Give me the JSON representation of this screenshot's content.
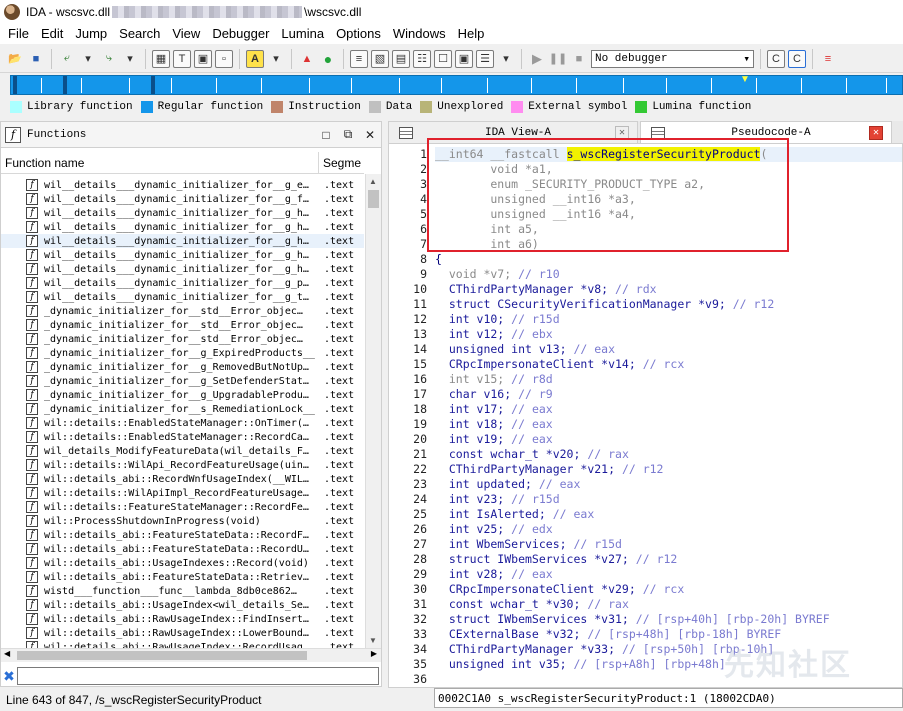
{
  "window": {
    "title_prefix": "IDA - wscsvc.dll",
    "title_suffix": "\\wscsvc.dll"
  },
  "menu": [
    "File",
    "Edit",
    "Jump",
    "Search",
    "View",
    "Debugger",
    "Lumina",
    "Options",
    "Windows",
    "Help"
  ],
  "toolbar": {
    "debugger_value": "No debugger"
  },
  "legend": [
    {
      "label": "Library function",
      "color": "#aaffff"
    },
    {
      "label": "Regular function",
      "color": "#1496ea"
    },
    {
      "label": "Instruction",
      "color": "#c0846a"
    },
    {
      "label": "Data",
      "color": "#c0c0c0"
    },
    {
      "label": "Unexplored",
      "color": "#b8b478"
    },
    {
      "label": "External symbol",
      "color": "#ff8cf0"
    },
    {
      "label": "Lumina function",
      "color": "#34c934"
    }
  ],
  "functions": {
    "title": "Functions",
    "col_name": "Function name",
    "col_segment": "Segme",
    "rows": [
      {
        "name": "wil__details___dynamic_initializer_for__g_e…",
        "seg": ".text"
      },
      {
        "name": "wil__details___dynamic_initializer_for__g_f…",
        "seg": ".text"
      },
      {
        "name": "wil__details___dynamic_initializer_for__g_h…",
        "seg": ".text"
      },
      {
        "name": "wil__details___dynamic_initializer_for__g_h…",
        "seg": ".text"
      },
      {
        "name": "wil__details___dynamic_initializer_for__g_h…",
        "seg": ".text"
      },
      {
        "name": "wil__details___dynamic_initializer_for__g_h…",
        "seg": ".text"
      },
      {
        "name": "wil__details___dynamic_initializer_for__g_h…",
        "seg": ".text"
      },
      {
        "name": "wil__details___dynamic_initializer_for__g_p…",
        "seg": ".text"
      },
      {
        "name": "wil__details___dynamic_initializer_for__g_t…",
        "seg": ".text"
      },
      {
        "name": "_dynamic_initializer_for__std__Error_objec…",
        "seg": ".text"
      },
      {
        "name": "_dynamic_initializer_for__std__Error_objec…",
        "seg": ".text"
      },
      {
        "name": "_dynamic_initializer_for__std__Error_objec…",
        "seg": ".text"
      },
      {
        "name": "_dynamic_initializer_for__g_ExpiredProducts__",
        "seg": ".text"
      },
      {
        "name": "_dynamic_initializer_for__g_RemovedButNotUp…",
        "seg": ".text"
      },
      {
        "name": "_dynamic_initializer_for__g_SetDefenderStat…",
        "seg": ".text"
      },
      {
        "name": "_dynamic_initializer_for__g_UpgradableProdu…",
        "seg": ".text"
      },
      {
        "name": "_dynamic_initializer_for__s_RemediationLock__",
        "seg": ".text"
      },
      {
        "name": "wil::details::EnabledStateManager::OnTimer(…",
        "seg": ".text"
      },
      {
        "name": "wil::details::EnabledStateManager::RecordCa…",
        "seg": ".text"
      },
      {
        "name": "wil_details_ModifyFeatureData(wil_details_F…",
        "seg": ".text"
      },
      {
        "name": "wil::details::WilApi_RecordFeatureUsage(uin…",
        "seg": ".text"
      },
      {
        "name": "wil::details_abi::RecordWnfUsageIndex(__WIL…",
        "seg": ".text"
      },
      {
        "name": "wil::details::WilApiImpl_RecordFeatureUsage…",
        "seg": ".text"
      },
      {
        "name": "wil::details::FeatureStateManager::RecordFe…",
        "seg": ".text"
      },
      {
        "name": "wil::ProcessShutdownInProgress(void)",
        "seg": ".text"
      },
      {
        "name": "wil::details_abi::FeatureStateData::RecordF…",
        "seg": ".text"
      },
      {
        "name": "wil::details_abi::FeatureStateData::RecordU…",
        "seg": ".text"
      },
      {
        "name": "wil::details_abi::UsageIndexes::Record(void)",
        "seg": ".text"
      },
      {
        "name": "wil::details_abi::FeatureStateData::Retriev…",
        "seg": ".text"
      },
      {
        "name": "wistd___function___func__lambda_8db0ce862…",
        "seg": ".text"
      },
      {
        "name": "wil::details_abi::UsageIndex<wil_details_Se…",
        "seg": ".text"
      },
      {
        "name": "wil::details_abi::RawUsageIndex::FindInsert…",
        "seg": ".text"
      },
      {
        "name": "wil::details_abi::RawUsageIndex::LowerBound…",
        "seg": ".text"
      },
      {
        "name": "wil::details_abi::RawUsageIndex::RecordUsag…",
        "seg": ".text"
      }
    ]
  },
  "status": {
    "text": "Line 643 of 847, /s_wscRegisterSecurityProduct"
  },
  "tabs": [
    {
      "label": "IDA View-A"
    },
    {
      "label": "Pseudocode-A"
    }
  ],
  "code": {
    "lines": [
      {
        "n": "1",
        "segs": [
          {
            "t": "__int64 __fastcall ",
            "c": "kw-gray"
          },
          {
            "t": "s_wscRegisterSecurityProduct",
            "c": "hl"
          },
          {
            "t": "(",
            "c": "kw-gray"
          }
        ]
      },
      {
        "n": "2",
        "segs": [
          {
            "t": "        void *a1,",
            "c": "kw-gray"
          }
        ]
      },
      {
        "n": "3",
        "segs": [
          {
            "t": "        enum _SECURITY_PRODUCT_TYPE a2,",
            "c": "kw-gray"
          }
        ]
      },
      {
        "n": "4",
        "segs": [
          {
            "t": "        unsigned __int16 *a3,",
            "c": "kw-gray"
          }
        ]
      },
      {
        "n": "5",
        "segs": [
          {
            "t": "        unsigned __int16 *a4,",
            "c": "kw-gray"
          }
        ]
      },
      {
        "n": "6",
        "segs": [
          {
            "t": "        int a5,",
            "c": "kw-gray"
          }
        ]
      },
      {
        "n": "7",
        "segs": [
          {
            "t": "        int a6)",
            "c": "kw-gray"
          }
        ]
      },
      {
        "n": "8",
        "segs": [
          {
            "t": "{",
            "c": "plain"
          }
        ]
      },
      {
        "n": "9",
        "segs": [
          {
            "t": "  void *v7; ",
            "c": "kw-gray"
          },
          {
            "t": "// r10",
            "c": "cmt"
          }
        ]
      },
      {
        "n": "10",
        "segs": [
          {
            "t": "  CThirdPartyManager *v8; ",
            "c": "kw-blue"
          },
          {
            "t": "// rdx",
            "c": "cmt"
          }
        ]
      },
      {
        "n": "11",
        "segs": [
          {
            "t": "  struct CSecurityVerificationManager *v9; ",
            "c": "kw-blue"
          },
          {
            "t": "// r12",
            "c": "cmt"
          }
        ]
      },
      {
        "n": "12",
        "segs": [
          {
            "t": "  int v10; ",
            "c": "kw-blue"
          },
          {
            "t": "// r15d",
            "c": "cmt"
          }
        ]
      },
      {
        "n": "13",
        "segs": [
          {
            "t": "  int v12; ",
            "c": "kw-blue"
          },
          {
            "t": "// ebx",
            "c": "cmt"
          }
        ]
      },
      {
        "n": "14",
        "segs": [
          {
            "t": "  unsigned int v13; ",
            "c": "kw-blue"
          },
          {
            "t": "// eax",
            "c": "cmt"
          }
        ]
      },
      {
        "n": "15",
        "segs": [
          {
            "t": "  CRpcImpersonateClient *v14; ",
            "c": "kw-blue"
          },
          {
            "t": "// rcx",
            "c": "cmt"
          }
        ]
      },
      {
        "n": "16",
        "segs": [
          {
            "t": "  int v15; ",
            "c": "kw-gray"
          },
          {
            "t": "// r8d",
            "c": "cmt"
          }
        ]
      },
      {
        "n": "17",
        "segs": [
          {
            "t": "  char v16; ",
            "c": "kw-blue"
          },
          {
            "t": "// r9",
            "c": "cmt"
          }
        ]
      },
      {
        "n": "18",
        "segs": [
          {
            "t": "  int v17; ",
            "c": "kw-blue"
          },
          {
            "t": "// eax",
            "c": "cmt"
          }
        ]
      },
      {
        "n": "19",
        "segs": [
          {
            "t": "  int v18; ",
            "c": "kw-blue"
          },
          {
            "t": "// eax",
            "c": "cmt"
          }
        ]
      },
      {
        "n": "20",
        "segs": [
          {
            "t": "  int v19; ",
            "c": "kw-blue"
          },
          {
            "t": "// eax",
            "c": "cmt"
          }
        ]
      },
      {
        "n": "21",
        "segs": [
          {
            "t": "  const wchar_t *v20; ",
            "c": "kw-blue"
          },
          {
            "t": "// rax",
            "c": "cmt"
          }
        ]
      },
      {
        "n": "22",
        "segs": [
          {
            "t": "  CThirdPartyManager *v21; ",
            "c": "kw-blue"
          },
          {
            "t": "// r12",
            "c": "cmt"
          }
        ]
      },
      {
        "n": "23",
        "segs": [
          {
            "t": "  int updated; ",
            "c": "kw-blue"
          },
          {
            "t": "// eax",
            "c": "cmt"
          }
        ]
      },
      {
        "n": "24",
        "segs": [
          {
            "t": "  int v23; ",
            "c": "kw-blue"
          },
          {
            "t": "// r15d",
            "c": "cmt"
          }
        ]
      },
      {
        "n": "25",
        "segs": [
          {
            "t": "  int IsAlerted; ",
            "c": "kw-blue"
          },
          {
            "t": "// eax",
            "c": "cmt"
          }
        ]
      },
      {
        "n": "26",
        "segs": [
          {
            "t": "  int v25; ",
            "c": "kw-blue"
          },
          {
            "t": "// edx",
            "c": "cmt"
          }
        ]
      },
      {
        "n": "27",
        "segs": [
          {
            "t": "  int WbemServices; ",
            "c": "kw-blue"
          },
          {
            "t": "// r15d",
            "c": "cmt"
          }
        ]
      },
      {
        "n": "28",
        "segs": [
          {
            "t": "  struct IWbemServices *v27; ",
            "c": "kw-blue"
          },
          {
            "t": "// r12",
            "c": "cmt"
          }
        ]
      },
      {
        "n": "29",
        "segs": [
          {
            "t": "  int v28; ",
            "c": "kw-blue"
          },
          {
            "t": "// eax",
            "c": "cmt"
          }
        ]
      },
      {
        "n": "30",
        "segs": [
          {
            "t": "  CRpcImpersonateClient *v29; ",
            "c": "kw-blue"
          },
          {
            "t": "// rcx",
            "c": "cmt"
          }
        ]
      },
      {
        "n": "31",
        "segs": [
          {
            "t": "  const wchar_t *v30; ",
            "c": "kw-blue"
          },
          {
            "t": "// rax",
            "c": "cmt"
          }
        ]
      },
      {
        "n": "32",
        "segs": [
          {
            "t": "  struct IWbemServices *v31; ",
            "c": "kw-blue"
          },
          {
            "t": "// [rsp+40h] [rbp-20h] BYREF",
            "c": "cmt"
          }
        ]
      },
      {
        "n": "33",
        "segs": [
          {
            "t": "  CExternalBase *v32; ",
            "c": "kw-blue"
          },
          {
            "t": "// [rsp+48h] [rbp-18h] BYREF",
            "c": "cmt"
          }
        ]
      },
      {
        "n": "34",
        "segs": [
          {
            "t": "  CThirdPartyManager *v33; ",
            "c": "kw-blue"
          },
          {
            "t": "// [rsp+50h] [rbp-10h]",
            "c": "cmt"
          }
        ]
      },
      {
        "n": "35",
        "segs": [
          {
            "t": "  unsigned int v35; ",
            "c": "kw-blue"
          },
          {
            "t": "// [rsp+A8h] [rbp+48h]",
            "c": "cmt"
          }
        ]
      },
      {
        "n": "36",
        "segs": [
          {
            "t": "",
            "c": "plain"
          }
        ]
      }
    ],
    "status": "0002C1A0 s_wscRegisterSecurityProduct:1 (18002CDA0)"
  },
  "watermark": "先知社区"
}
